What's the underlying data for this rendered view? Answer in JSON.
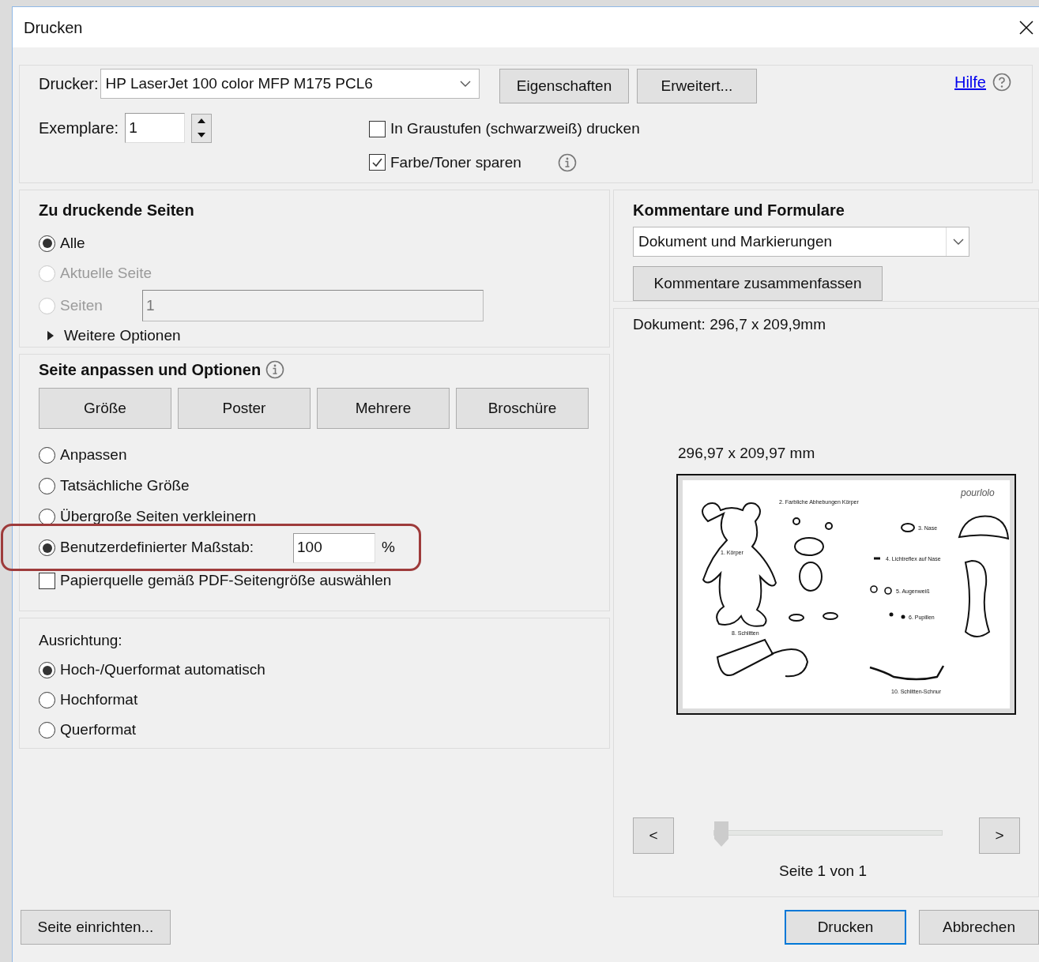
{
  "window": {
    "title": "Drucken"
  },
  "printer": {
    "label": "Drucker:",
    "value": "HP LaserJet 100 color MFP M175 PCL6"
  },
  "top_buttons": [
    "Eigenschaften",
    "Erweitert..."
  ],
  "help": {
    "label": "Hilfe"
  },
  "copies": {
    "label": "Exemplare:",
    "value": "1"
  },
  "color_options": [
    {
      "label": "In Graustufen (schwarzweiß) drucken",
      "checked": false,
      "info": false
    },
    {
      "label": "Farbe/Toner sparen",
      "checked": true,
      "info": true
    }
  ],
  "pages": {
    "title": "Zu druckende Seiten",
    "options": [
      {
        "kind": "plain",
        "label": "Alle",
        "selected": true,
        "disabled": false
      },
      {
        "kind": "plain",
        "label": "Aktuelle Seite",
        "selected": false,
        "disabled": true
      },
      {
        "kind": "range",
        "label": "Seiten",
        "selected": false,
        "disabled": true,
        "value": "1"
      }
    ],
    "more": {
      "label": "Weitere Optionen",
      "expanded": false
    }
  },
  "fit": {
    "title": "Seite anpassen und Optionen",
    "modes": [
      "Größe",
      "Poster",
      "Mehrere",
      "Broschüre"
    ],
    "scale_options": [
      {
        "kind": "plain",
        "label": "Anpassen",
        "selected": false
      },
      {
        "kind": "plain",
        "label": "Tatsächliche Größe",
        "selected": false
      },
      {
        "kind": "plain",
        "label": "Übergroße Seiten verkleinern",
        "selected": false
      },
      {
        "kind": "custom",
        "label": "Benutzerdefinierter Maßstab:",
        "selected": true,
        "value": "100",
        "unit": "%"
      }
    ],
    "paper_source": {
      "label": "Papierquelle gemäß PDF-Seitengröße auswählen",
      "checked": false
    }
  },
  "orientation": {
    "title": "Ausrichtung:",
    "options": [
      {
        "label": "Hoch-/Querformat automatisch",
        "selected": true
      },
      {
        "label": "Hochformat",
        "selected": false
      },
      {
        "label": "Querformat",
        "selected": false
      }
    ]
  },
  "comments": {
    "title": "Kommentare und Formulare",
    "value": "Dokument und Markierungen",
    "button": "Kommentare zusammenfassen"
  },
  "preview": {
    "document_size": "Dokument: 296,7 x 209,9mm",
    "page_size": "296,97 x 209,97 mm",
    "page_texts": [
      "2. Farbliche Abhebungen Körper",
      "1. Körper",
      "3. Nase",
      "4. Lichtreflex auf Nase",
      "5. Augenweiß",
      "6. Pupillen",
      "8. Schlitten",
      "10. Schlitten-Schnur",
      "pourlolo"
    ],
    "prev": "<",
    "next": ">",
    "slider": {
      "level": 0
    },
    "page_label": "Seite 1 von 1"
  },
  "footer": {
    "setup": "Seite einrichten...",
    "buttons": [
      {
        "label": "Drucken",
        "default": true
      },
      {
        "label": "Abbrechen",
        "default": false
      }
    ]
  }
}
